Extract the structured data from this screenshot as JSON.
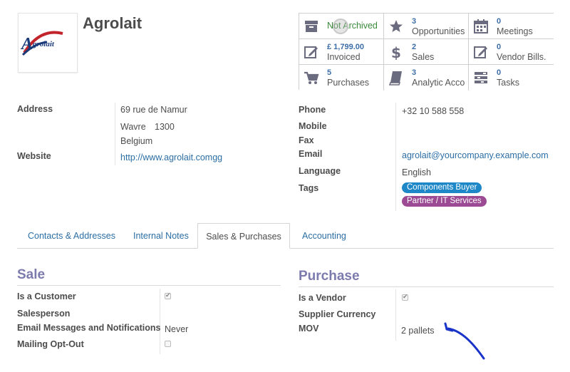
{
  "record": {
    "name": "Agrolait",
    "logo_text": "grolait"
  },
  "smart_buttons": [
    {
      "value": "",
      "label": "Not Archived",
      "icon": "archive-icon"
    },
    {
      "value": "3",
      "label": "Opportunities",
      "icon": "star-icon"
    },
    {
      "value": "0",
      "label": "Meetings",
      "icon": "calendar-icon"
    },
    {
      "value": "£ 1,799.00",
      "label": "Invoiced",
      "icon": "edit-icon"
    },
    {
      "value": "2",
      "label": "Sales",
      "icon": "dollar-icon"
    },
    {
      "value": "0",
      "label": "Vendor Bills.",
      "icon": "edit-icon"
    },
    {
      "value": "5",
      "label": "Purchases",
      "icon": "cart-icon"
    },
    {
      "value": "3",
      "label": "Analytic Acco…",
      "icon": "book-icon"
    },
    {
      "value": "0",
      "label": "Tasks",
      "icon": "tasks-icon"
    }
  ],
  "left_fields": {
    "address_label": "Address",
    "street": "69 rue de Namur",
    "city": "Wavre",
    "zip": "1300",
    "country": "Belgium",
    "website_label": "Website",
    "website": "http://www.agrolait.comgg"
  },
  "right_fields": {
    "phone_label": "Phone",
    "phone": "+32 10 588 558",
    "mobile_label": "Mobile",
    "fax_label": "Fax",
    "email_label": "Email",
    "email": "agrolait@yourcompany.example.com",
    "language_label": "Language",
    "language": "English",
    "tags_label": "Tags",
    "tags": [
      {
        "label": "Components Buyer",
        "color": "#1e87c8"
      },
      {
        "label": "Partner / IT Services",
        "color": "#9b4a93"
      }
    ]
  },
  "tabs": [
    {
      "label": "Contacts & Addresses",
      "active": false
    },
    {
      "label": "Internal Notes",
      "active": false
    },
    {
      "label": "Sales & Purchases",
      "active": true
    },
    {
      "label": "Accounting",
      "active": false
    }
  ],
  "sale": {
    "title": "Sale",
    "is_customer_label": "Is a Customer",
    "is_customer": true,
    "salesperson_label": "Salesperson",
    "email_notif_label": "Email Messages and Notifications",
    "email_notif_value": "Never",
    "mailing_optout_label": "Mailing Opt-Out",
    "mailing_optout": false
  },
  "purchase": {
    "title": "Purchase",
    "is_vendor_label": "Is a Vendor",
    "is_vendor": true,
    "supplier_currency_label": "Supplier Currency",
    "mov_label": "MOV",
    "mov_value": "2 pallets"
  },
  "colors": {
    "accent": "#7c7bad",
    "link": "#2c6ea4",
    "annotation": "#1a33c8"
  }
}
